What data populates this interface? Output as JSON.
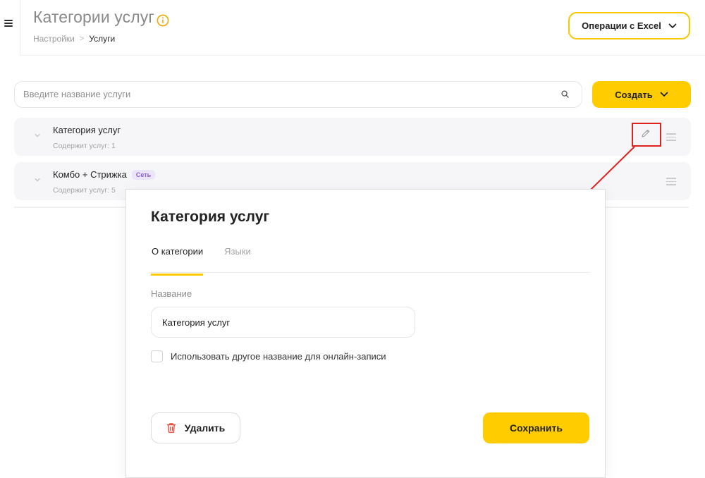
{
  "header": {
    "title": "Категории услуг",
    "breadcrumb": {
      "parent": "Настройки",
      "separator": ">",
      "current": "Услуги"
    },
    "excel_button": "Операции с Excel"
  },
  "toolbar": {
    "search_placeholder": "Введите название услуги",
    "create_button": "Создать"
  },
  "categories": [
    {
      "name": "Категория услуг",
      "count": "Содержит услуг: 1",
      "badge": ""
    },
    {
      "name": "Комбо + Стрижка",
      "count": "Содержит услуг: 5",
      "badge": "Сеть"
    }
  ],
  "modal": {
    "title": "Категория услуг",
    "tabs": [
      {
        "label": "О категории",
        "active": true
      },
      {
        "label": "Языки",
        "active": false
      }
    ],
    "name_label": "Название",
    "name_value": "Категория услуг",
    "checkbox_label": "Использовать другое название для онлайн-записи",
    "checkbox_checked": false,
    "delete_button": "Удалить",
    "save_button": "Сохранить"
  },
  "colors": {
    "accent": "#ffcc00",
    "annotation": "#e0221f",
    "badge_text": "#8a5ed9",
    "badge_bg": "#ece4fb",
    "info_icon": "#f0a900",
    "delete_icon": "#e44a3a"
  },
  "icons": [
    "menu-icon",
    "info-icon",
    "chevron-down-icon",
    "search-icon",
    "pencil-icon",
    "drag-handle-icon",
    "trash-icon"
  ]
}
